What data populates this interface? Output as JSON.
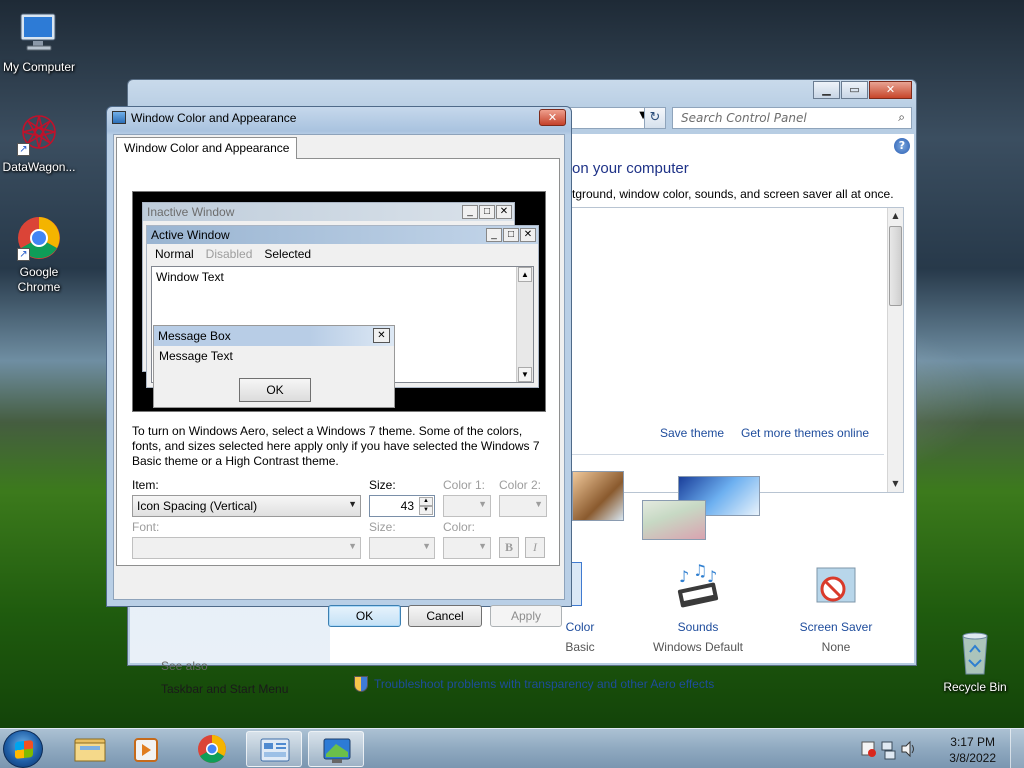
{
  "desktop": {
    "icons": [
      {
        "label": "My Computer"
      },
      {
        "label": "DataWagon..."
      },
      {
        "label": "Google Chrome"
      },
      {
        "label": "Recycle Bin"
      }
    ]
  },
  "control_panel": {
    "search_placeholder": "Search Control Panel",
    "heading": "on your computer",
    "subheading": "tground, window color, sounds, and screen saver all at once.",
    "save_theme": "Save theme",
    "get_more_themes": "Get more themes online",
    "tiles": [
      {
        "label": "Color",
        "value": "Basic"
      },
      {
        "label": "Sounds",
        "value": "Windows Default"
      },
      {
        "label": "Screen Saver",
        "value": "None"
      }
    ],
    "see_also": "See also",
    "taskbar_link": "Taskbar and Start Menu",
    "troubleshoot": "Troubleshoot problems with transparency and other Aero effects"
  },
  "dialog": {
    "title": "Window Color and Appearance",
    "tab": "Window Color and Appearance",
    "preview": {
      "inactive_title": "Inactive Window",
      "active_title": "Active Window",
      "menu": [
        "Normal",
        "Disabled",
        "Selected"
      ],
      "window_text": "Window Text",
      "message_box_title": "Message Box",
      "message_text": "Message Text",
      "ok": "OK"
    },
    "info": "To turn on Windows Aero, select a Windows 7 theme.  Some of the colors, fonts, and sizes selected here apply only if you have selected the Windows 7 Basic theme or a High Contrast theme.",
    "labels": {
      "item": "Item:",
      "size": "Size:",
      "color1": "Color 1:",
      "color2": "Color 2:",
      "font": "Font:",
      "font_size": "Size:",
      "font_color": "Color:"
    },
    "item_value": "Icon Spacing (Vertical)",
    "size_value": "43",
    "bold": "B",
    "italic": "I",
    "buttons": {
      "ok": "OK",
      "cancel": "Cancel",
      "apply": "Apply"
    }
  },
  "taskbar": {
    "time": "3:17 PM",
    "date": "3/8/2022"
  },
  "colors": {
    "link": "#1e4c9c",
    "heading": "#1e3287",
    "disabled": "#9d9d9d"
  }
}
